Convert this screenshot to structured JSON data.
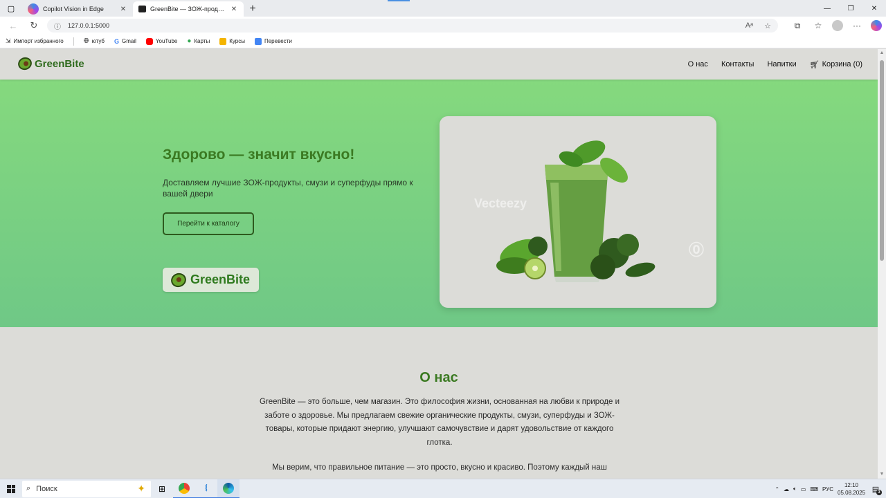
{
  "browser": {
    "tabs": [
      {
        "title": "Copilot Vision in Edge",
        "icon": "copilot-icon",
        "close": "✕"
      },
      {
        "title": "GreenBite — ЗОЖ-продукты",
        "icon": "page-icon",
        "close": "✕"
      }
    ],
    "new_tab": "+",
    "url": "127.0.0.1:5000",
    "bookmarks": [
      {
        "label": "Импорт избранного",
        "color": "#555555"
      },
      {
        "label": "ютуб",
        "color": "#555555"
      },
      {
        "label": "Gmail",
        "color": "#4285f4"
      },
      {
        "label": "YouTube",
        "color": "#ff0000"
      },
      {
        "label": "Карты",
        "color": "#34a853"
      },
      {
        "label": "Курсы",
        "color": "#f4b400"
      },
      {
        "label": "Перевести",
        "color": "#4285f4"
      }
    ]
  },
  "site": {
    "logo": "GreenBite",
    "nav": [
      "О нас",
      "Контакты",
      "Напитки"
    ],
    "cart": "Корзина (0)",
    "hero": {
      "title": "Здорово — значит вкусно!",
      "subtitle": "Доставляем лучшие ЗОЖ-продукты, смузи и суперфуды прямо к вашей двери",
      "cta": "Перейти к каталогу",
      "badge": "GreenBite",
      "image_watermark": "Vecteezy"
    },
    "about": {
      "title": "О нас",
      "p1": "GreenBite — это больше, чем магазин. Это философия жизни, основанная на любви к природе и заботе о здоровье. Мы предлагаем свежие органические продукты, смузи, суперфуды и ЗОЖ-товары, которые придают энергию, улучшают самочувствие и дарят удовольствие от каждого глотка.",
      "p2": "Мы верим, что правильное питание — это просто, вкусно и красиво. Поэтому каждый наш"
    }
  },
  "taskbar": {
    "search_placeholder": "Поиск",
    "lang": "РУС",
    "time": "12:10",
    "date": "05.08.2025",
    "notifications": "3"
  },
  "colors": {
    "brand_green": "#3b7a22",
    "hero_top": "#85d97e",
    "hero_bottom": "#6fc886"
  }
}
